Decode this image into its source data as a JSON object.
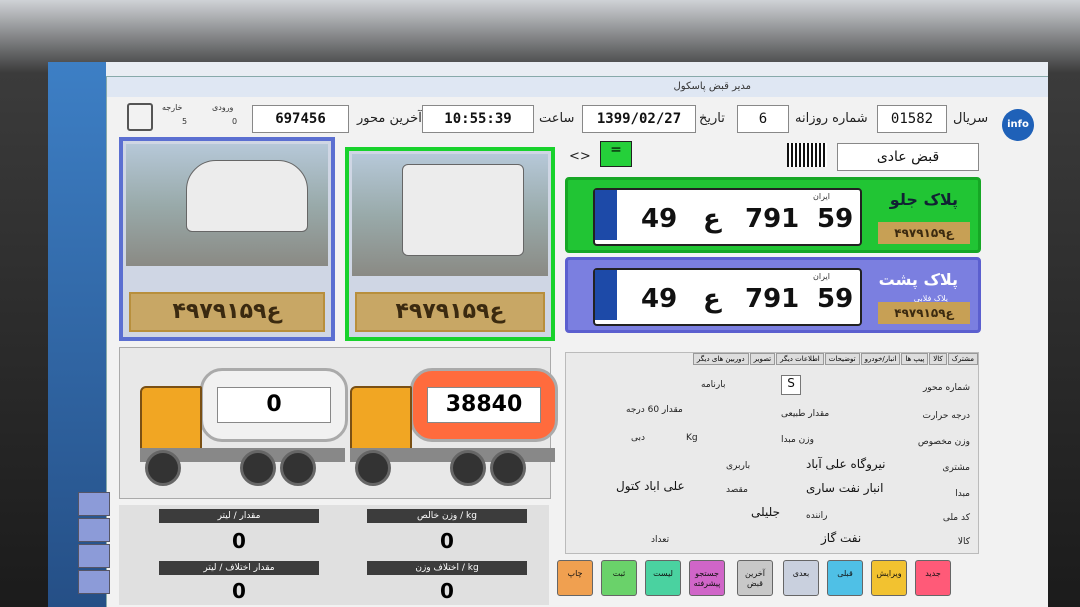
{
  "app": {
    "title": "مدیر قبض پاسکول"
  },
  "header": {
    "serial_label": "سریال",
    "serial": "01582",
    "daily_label": "شماره روزانه",
    "daily": "6",
    "date_label": "تاریخ",
    "date": "1399/02/27",
    "time_label": "ساعت",
    "time": "10:55:39",
    "last_axle_label": "آخرین محور",
    "last_axle": "697456",
    "in_label": "ورودی",
    "in_value": "0",
    "out_label": "خارجه",
    "out_value": "5",
    "receipt_type": "قبض عادی",
    "nav_arrows": "<>",
    "nav_equal": "="
  },
  "plates": {
    "front": {
      "title": "پلاک جلو",
      "left": "49",
      "letter": "ع",
      "mid": "791",
      "right": "59",
      "country": "ایران",
      "capture": "۴۹ع۷۹۱۵۹"
    },
    "rear": {
      "title": "پلاک پشت",
      "left": "49",
      "letter": "ع",
      "mid": "791",
      "right": "59",
      "country": "ایران",
      "capture": "۴۹ع۷۹۱۵۹",
      "note": "پلاک فلابی"
    },
    "cam1_capture": "۴۹ع۷۹۱۵۹",
    "cam2_capture": "۴۹ع۷۹۱۵۹"
  },
  "weights": {
    "tank1": "38840",
    "tank2": "0"
  },
  "stats": {
    "net_weight_label": "وزن خالص / kg",
    "net_weight": "0",
    "amount_label": "مقدار / لیتر",
    "amount": "0",
    "diff_weight_label": "اختلاف وزن / kg",
    "diff_weight": "0",
    "diff_amount_label": "مقدار اختلاف / لیتر",
    "diff_amount": "0"
  },
  "form": {
    "tabs": [
      "مشترک",
      "کالا",
      "پیپ ها",
      "انبار/خودرو",
      "توضیحات",
      "اطلاعات دیگر",
      "تصویر",
      "دوربین های دیگر"
    ],
    "axle_no_label": "شماره محور",
    "axle_no": "S",
    "waybill_label": "بارنامه",
    "temp_label": "درجه حرارت",
    "natural_label": "مقدار طبیعی",
    "amount60_label": "مقدار 60 درجه",
    "density_label": "وزن مخصوص",
    "base_weight_label": "وزن مبدا",
    "kg": "Kg",
    "flow_label": "دبی",
    "customer_label": "مشتری",
    "customer": "نیروگاه علی آباد",
    "carrier_label": "باربری",
    "origin_label": "مبدا",
    "origin": "انبار نفت ساری",
    "dest_label": "مقصد",
    "dest": "علی اباد کتول",
    "code_label": "کد ملی",
    "driver_label": "راننده",
    "driver": "جلیلی",
    "goods_label": "کالا",
    "goods": "نفت گاز",
    "count_label": "تعداد"
  },
  "buttons": {
    "new": "جدید",
    "edit": "ویرایش",
    "prev": "قبلی",
    "next": "بعدی",
    "last": "آخرین قبض",
    "search": "جستجو پیشرفته",
    "list": "لیست",
    "save": "ثبت",
    "print": "چاپ"
  },
  "colors": {
    "blue_frame": "#5b6fd1",
    "green_frame": "#18d22c",
    "front_panel": "#17c92a",
    "rear_panel": "#7b7fe0"
  }
}
